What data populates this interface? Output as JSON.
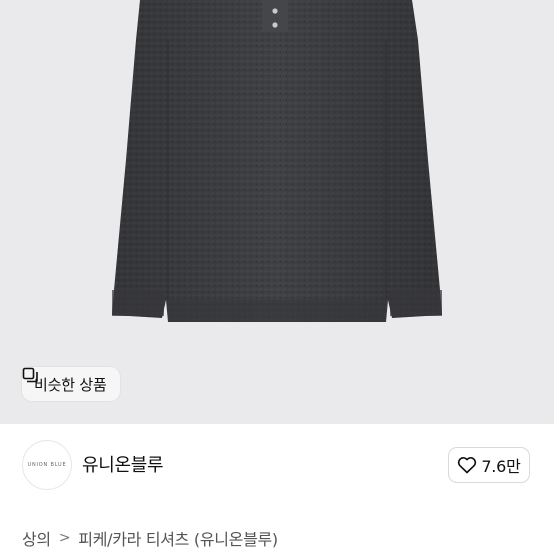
{
  "product": {
    "similar_button_label": "비슷한 상품"
  },
  "brand": {
    "logo_text": "UNION BLUE",
    "name": "유니온블루",
    "like_count": "7.6만"
  },
  "breadcrumb": {
    "category": "상의",
    "separator": ">",
    "subcategory": "피케/카라 티셔츠 (유니온블루)"
  },
  "colors": {
    "hero_background": "#eaeaec",
    "sweater": "#3d3e41"
  },
  "icons": {
    "similar": "similar-items-icon",
    "like": "heart-outline-icon"
  }
}
